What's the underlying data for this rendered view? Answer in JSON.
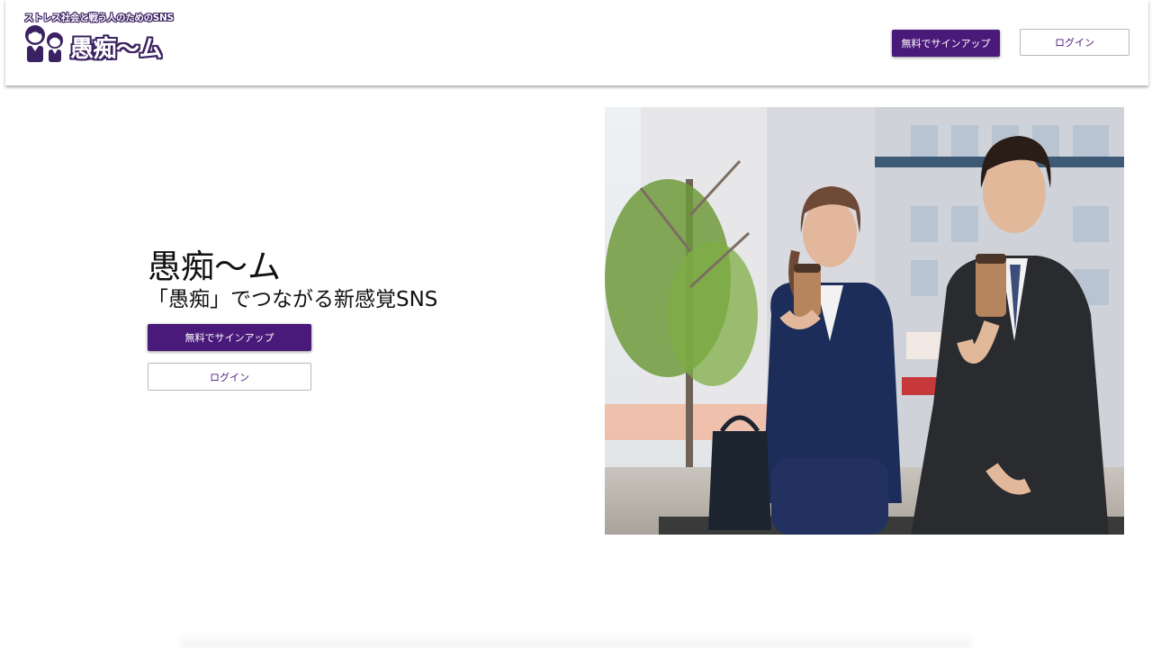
{
  "header": {
    "logo": {
      "tagline": "ストレス社会と戦う人のためのSNS",
      "name": "愚痴〜ム",
      "accent_color": "#3a2161"
    },
    "signup_label": "無料でサインアップ",
    "login_label": "ログイン"
  },
  "hero": {
    "title": "愚痴〜ム",
    "subtitle": "「愚痴」でつながる新感覚SNS",
    "signup_label": "無料でサインアップ",
    "login_label": "ログイン",
    "photo_icon": "office-workers-coffee-photo"
  },
  "colors": {
    "primary": "#4a1a7a",
    "outline_border": "#b9b9b9",
    "background": "#ffffff"
  }
}
